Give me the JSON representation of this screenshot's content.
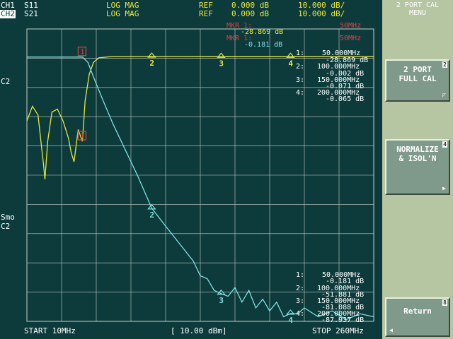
{
  "header": {
    "ch1_label": "CH1",
    "ch2_label": "CH2",
    "ch1_param": "S11",
    "ch2_param": "S21",
    "ch1_format": "LOG MAG",
    "ch2_format": "LOG MAG",
    "ch1_ref_label": "REF",
    "ch2_ref_label": "REF",
    "ch1_ref_value": "0.000 dB",
    "ch2_ref_value": "0.000 dB",
    "ch1_scale": "10.000 dB/",
    "ch2_scale": "10.000 dB/"
  },
  "left_annotations": {
    "c2_top": "C2",
    "smo": "Smo",
    "c2_bottom": "C2"
  },
  "marker_readout_top": {
    "mkr1_label": "MKR 1:",
    "mkr1_value": "-28.869 dB",
    "mkr1_freq": "50MHz",
    "mkr2_label": "MKR 1:",
    "mkr2_value": "-0.181 dB",
    "mkr2_freq": "50MHz"
  },
  "marker_table_ch1": [
    {
      "index": "1:",
      "freq": "50.000MHz",
      "value": "-28.869 dB"
    },
    {
      "index": "2:",
      "freq": "100.000MHz",
      "value": "-0.002 dB"
    },
    {
      "index": "3:",
      "freq": "150.000MHz",
      "value": "-0.071 dB"
    },
    {
      "index": "4:",
      "freq": "200.000MHz",
      "value": "-0.065 dB"
    }
  ],
  "marker_table_ch2": [
    {
      "index": "1:",
      "freq": "50.000MHz",
      "value": "-0.181 dB"
    },
    {
      "index": "2:",
      "freq": "100.000MHz",
      "value": "-51.881 dB"
    },
    {
      "index": "3:",
      "freq": "150.000MHz",
      "value": "-81.088 dB"
    },
    {
      "index": "4:",
      "freq": "200.000MHz",
      "value": "-87.937 dB"
    }
  ],
  "markers_ch1": [
    {
      "number": "1",
      "type": "active"
    },
    {
      "number": "2",
      "type": "delta"
    },
    {
      "number": "3",
      "type": "delta"
    },
    {
      "number": "4",
      "type": "delta"
    }
  ],
  "markers_ch2": [
    {
      "number": "1",
      "type": "active"
    },
    {
      "number": "2",
      "type": "delta"
    },
    {
      "number": "3",
      "type": "delta"
    },
    {
      "number": "4",
      "type": "delta"
    }
  ],
  "footer": {
    "start": "START 10MHz",
    "power": "[ 10.00 dBm]",
    "stop": "STOP 260MHz"
  },
  "menu": {
    "title_line1": "2 PORT CAL",
    "title_line2": "MENU",
    "softkeys": [
      {
        "label_line1": "2 PORT",
        "label_line2": "FULL CAL",
        "index": "2"
      },
      {
        "label_line1": "NORMALIZE",
        "label_line2": "& ISOL'N",
        "index": "4"
      },
      {
        "label_line1": "Return",
        "label_line2": "",
        "index": "8"
      }
    ]
  },
  "colors": {
    "background": "#0d3b3c",
    "grid": "#c8d0c8",
    "ch1_trace": "#e8e83a",
    "ch2_trace": "#7fe0e0",
    "marker_active": "#e04040",
    "softkey_panel": "#b6c6a2"
  },
  "chart_data": {
    "type": "line",
    "x_start_mhz": 10,
    "x_stop_mhz": 260,
    "divisions_x": 10,
    "divisions_y": 10,
    "ref_db": 0,
    "scale_db_per_div": 10,
    "series": [
      {
        "name": "S11",
        "points_mhz_db": [
          [
            10,
            -22
          ],
          [
            14,
            -17
          ],
          [
            18,
            -20
          ],
          [
            22,
            -37
          ],
          [
            23,
            -42
          ],
          [
            25,
            -29
          ],
          [
            28,
            -19
          ],
          [
            32,
            -18
          ],
          [
            36,
            -22
          ],
          [
            40,
            -28
          ],
          [
            42,
            -33
          ],
          [
            44,
            -36
          ],
          [
            47,
            -25
          ],
          [
            50,
            -29
          ],
          [
            52,
            -15
          ],
          [
            55,
            -6
          ],
          [
            58,
            -2
          ],
          [
            62,
            -0.4
          ],
          [
            70,
            -0.1
          ],
          [
            100,
            -0.002
          ],
          [
            150,
            -0.071
          ],
          [
            200,
            -0.065
          ],
          [
            260,
            -0.06
          ]
        ]
      },
      {
        "name": "S21",
        "points_mhz_db": [
          [
            10,
            -0.2
          ],
          [
            30,
            -0.2
          ],
          [
            45,
            -0.2
          ],
          [
            50,
            -0.18
          ],
          [
            54,
            -2
          ],
          [
            58,
            -7
          ],
          [
            64,
            -14
          ],
          [
            72,
            -23
          ],
          [
            80,
            -31
          ],
          [
            90,
            -41
          ],
          [
            100,
            -51.9
          ],
          [
            110,
            -58
          ],
          [
            120,
            -64
          ],
          [
            130,
            -70
          ],
          [
            135,
            -75
          ],
          [
            140,
            -76
          ],
          [
            145,
            -80
          ],
          [
            150,
            -81.1
          ],
          [
            155,
            -82
          ],
          [
            160,
            -79
          ],
          [
            165,
            -84
          ],
          [
            170,
            -80
          ],
          [
            175,
            -86
          ],
          [
            180,
            -83
          ],
          [
            185,
            -87
          ],
          [
            190,
            -84
          ],
          [
            195,
            -89
          ],
          [
            200,
            -87.9
          ],
          [
            205,
            -88
          ],
          [
            210,
            -86
          ],
          [
            220,
            -89
          ],
          [
            230,
            -87
          ],
          [
            240,
            -90
          ],
          [
            250,
            -88
          ],
          [
            260,
            -89
          ]
        ]
      }
    ]
  }
}
